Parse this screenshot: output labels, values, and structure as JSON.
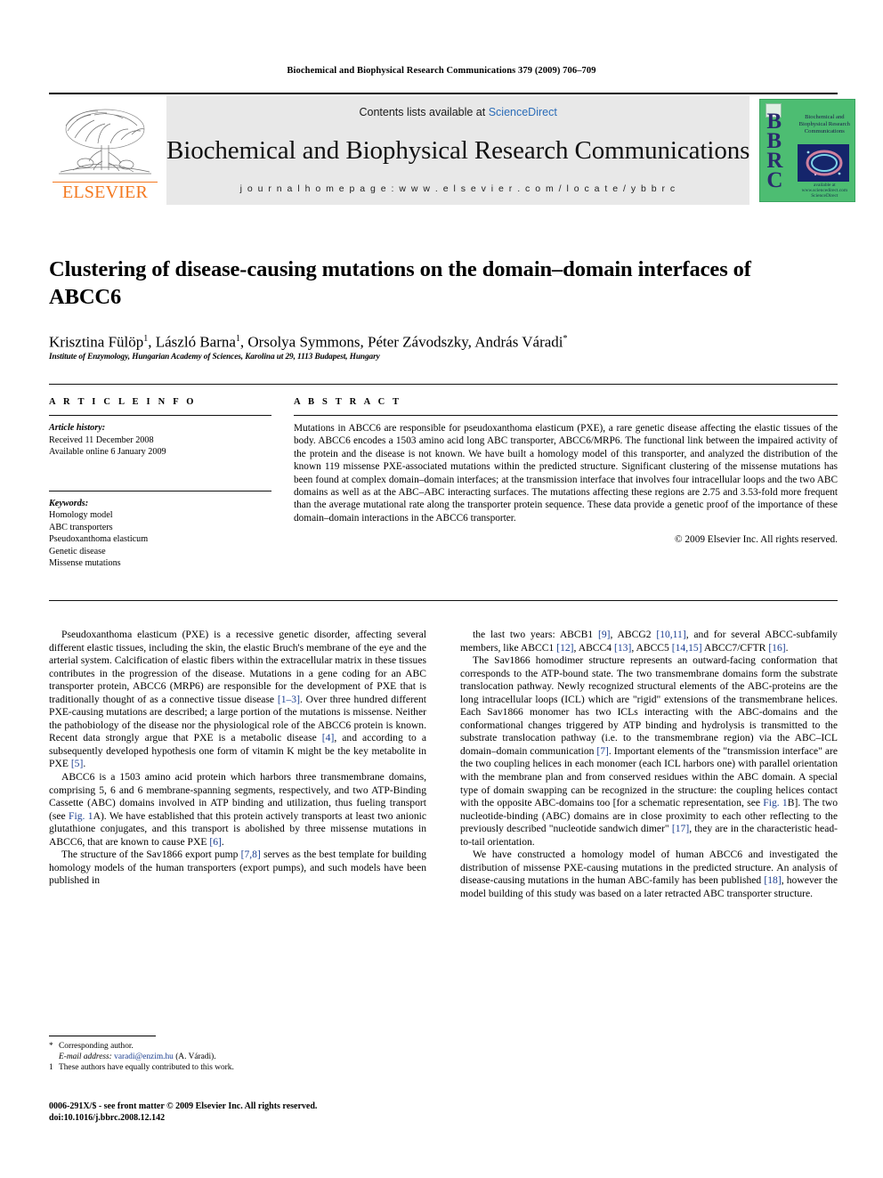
{
  "running_head": "Biochemical and Biophysical Research Communications 379 (2009) 706–709",
  "masthead": {
    "publisher": "ELSEVIER",
    "contents_prefix": "Contents lists available at ",
    "contents_link": "ScienceDirect",
    "journal_name": "Biochemical and Biophysical Research Communications",
    "homepage": "j o u r n a l   h o m e p a g e :   w w w . e l s e v i e r . c o m / l o c a t e / y b b r c",
    "cover": {
      "acronym": "BBRC",
      "title": "Biochemical and Biophysical Research Communications",
      "sciencedirect": "available at www.sciencedirect.com ScienceDirect"
    }
  },
  "article": {
    "title": "Clustering of disease-causing mutations on the domain–domain interfaces of ABCC6",
    "authors": "Krisztina Fülöp 1, László Barna 1, Orsolya Symmons, Péter Závodszky, András Váradi *",
    "affiliation": "Institute of Enzymology, Hungarian Academy of Sciences, Karolina ut 29, 1113 Budapest, Hungary"
  },
  "article_info": {
    "heading": "A R T I C L E   I N F O",
    "history_label": "Article history:",
    "received": "Received 11 December 2008",
    "available": "Available online 6 January 2009",
    "keywords_label": "Keywords:",
    "keywords": [
      "Homology model",
      "ABC transporters",
      "Pseudoxanthoma elasticum",
      "Genetic disease",
      "Missense mutations"
    ]
  },
  "abstract": {
    "heading": "A B S T R A C T",
    "text": "Mutations in ABCC6 are responsible for pseudoxanthoma elasticum (PXE), a rare genetic disease affecting the elastic tissues of the body. ABCC6 encodes a 1503 amino acid long ABC transporter, ABCC6/MRP6. The functional link between the impaired activity of the protein and the disease is not known. We have built a homology model of this transporter, and analyzed the distribution of the known 119 missense PXE-associated mutations within the predicted structure. Significant clustering of the missense mutations has been found at complex domain–domain interfaces; at the transmission interface that involves four intracellular loops and the two ABC domains as well as at the ABC–ABC interacting surfaces. The mutations affecting these regions are 2.75 and 3.53-fold more frequent than the average mutational rate along the transporter protein sequence. These data provide a genetic proof of the importance of these domain–domain interactions in the ABCC6 transporter.",
    "copyright": "© 2009 Elsevier Inc. All rights reserved."
  },
  "body": {
    "left_paragraphs": [
      "Pseudoxanthoma elasticum (PXE) is a recessive genetic disorder, affecting several different elastic tissues, including the skin, the elastic Bruch's membrane of the eye and the arterial system. Calcification of elastic fibers within the extracellular matrix in these tissues contributes in the progression of the disease. Mutations in a gene coding for an ABC transporter protein, ABCC6 (MRP6) are responsible for the development of PXE that is traditionally thought of as a connective tissue disease [1–3]. Over three hundred different PXE-causing mutations are described; a large portion of the mutations is missense. Neither the pathobiology of the disease nor the physiological role of the ABCC6 protein is known. Recent data strongly argue that PXE is a metabolic disease [4], and according to a subsequently developed hypothesis one form of vitamin K might be the key metabolite in PXE [5].",
      "ABCC6 is a 1503 amino acid protein which harbors three transmembrane domains, comprising 5, 6 and 6 membrane-spanning segments, respectively, and two ATP-Binding Cassette (ABC) domains involved in ATP binding and utilization, thus fueling transport (see Fig. 1A). We have established that this protein actively transports at least two anionic glutathione conjugates, and this transport is abolished by three missense mutations in ABCC6, that are known to cause PXE [6].",
      "The structure of the Sav1866 export pump [7,8] serves as the best template for building homology models of the human transporters (export pumps), and such models have been published in"
    ],
    "right_paragraphs": [
      "the last two years: ABCB1 [9], ABCG2 [10,11], and for several ABCC-subfamily members, like ABCC1 [12], ABCC4 [13], ABCC5 [14,15] ABCC7/CFTR [16].",
      "The Sav1866 homodimer structure represents an outward-facing conformation that corresponds to the ATP-bound state. The two transmembrane domains form the substrate translocation pathway. Newly recognized structural elements of the ABC-proteins are the long intracellular loops (ICL) which are \"rigid\" extensions of the transmembrane helices. Each Sav1866 monomer has two ICLs interacting with the ABC-domains and the conformational changes triggered by ATP binding and hydrolysis is transmitted to the substrate translocation pathway (i.e. to the transmembrane region) via the ABC–ICL domain–domain communication [7]. Important elements of the \"transmission interface\" are the two coupling helices in each monomer (each ICL harbors one) with parallel orientation with the membrane plan and from conserved residues within the ABC domain. A special type of domain swapping can be recognized in the structure: the coupling helices contact with the opposite ABC-domains too [for a schematic representation, see Fig. 1B]. The two nucleotide-binding (ABC) domains are in close proximity to each other reflecting to the previously described \"nucleotide sandwich dimer\" [17], they are in the characteristic head-to-tail orientation.",
      "We have constructed a homology model of human ABCC6 and investigated the distribution of missense PXE-causing mutations in the predicted structure. An analysis of disease-causing mutations in the human ABC-family has been published [18], however the model building of this study was based on a later retracted ABC transporter structure."
    ]
  },
  "footnotes": {
    "corresponding": "Corresponding author.",
    "email_label": "E-mail address:",
    "email": "varadi@enzim.hu",
    "email_suffix": " (A. Váradi).",
    "equal_contrib": "These authors have equally contributed to this work.",
    "marker_star": "*",
    "marker_one": "1"
  },
  "imprint": {
    "line1": "0006-291X/$ - see front matter © 2009 Elsevier Inc. All rights reserved.",
    "line2": "doi:10.1016/j.bbrc.2008.12.142"
  },
  "colors": {
    "elsevier_orange": "#F47920",
    "link_blue": "#2b6cb8",
    "reference_blue": "#1a3d8f",
    "cover_green": "#4dbd72",
    "band_gray": "#e8e8e8"
  }
}
